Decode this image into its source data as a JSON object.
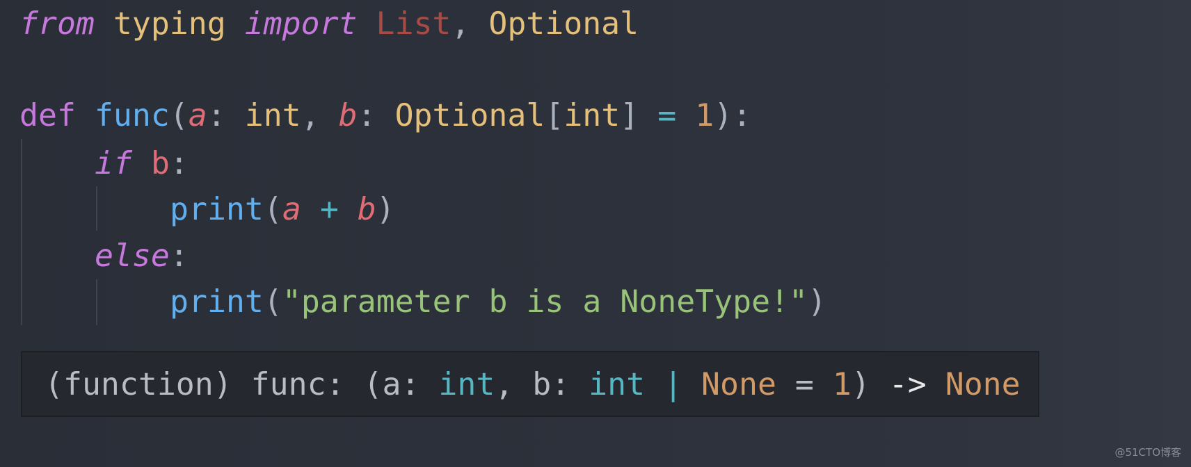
{
  "code": {
    "line1": {
      "from": "from",
      "module": "typing",
      "import": "import",
      "name1": "List",
      "comma": ",",
      "name2": "Optional"
    },
    "line3": {
      "def": "def",
      "fname": "func",
      "open": "(",
      "a": "a",
      "colon1": ":",
      "int1": "int",
      "comma": ",",
      "b": "b",
      "colon2": ":",
      "optional": "Optional",
      "lb": "[",
      "int2": "int",
      "rb": "]",
      "eq": "=",
      "default": "1",
      "close": "):"
    },
    "line4": {
      "if": "if",
      "b": "b",
      "colon": ":"
    },
    "line5": {
      "print": "print",
      "open": "(",
      "a": "a",
      "plus": "+",
      "b": "b",
      "close": ")"
    },
    "line6": {
      "else": "else",
      "colon": ":"
    },
    "line7": {
      "print": "print",
      "open": "(",
      "string": "\"parameter b is a NoneType!\"",
      "close": ")"
    }
  },
  "tooltip": {
    "prefix": "(function) func: (a: ",
    "int1": "int",
    "mid": ", b: ",
    "int2": "int",
    "bar": "|",
    "none1": "None",
    "eq": " = ",
    "default": "1",
    "close": ")",
    "arrow": "->",
    "none2": "None"
  },
  "watermark": "@51CTO博客"
}
